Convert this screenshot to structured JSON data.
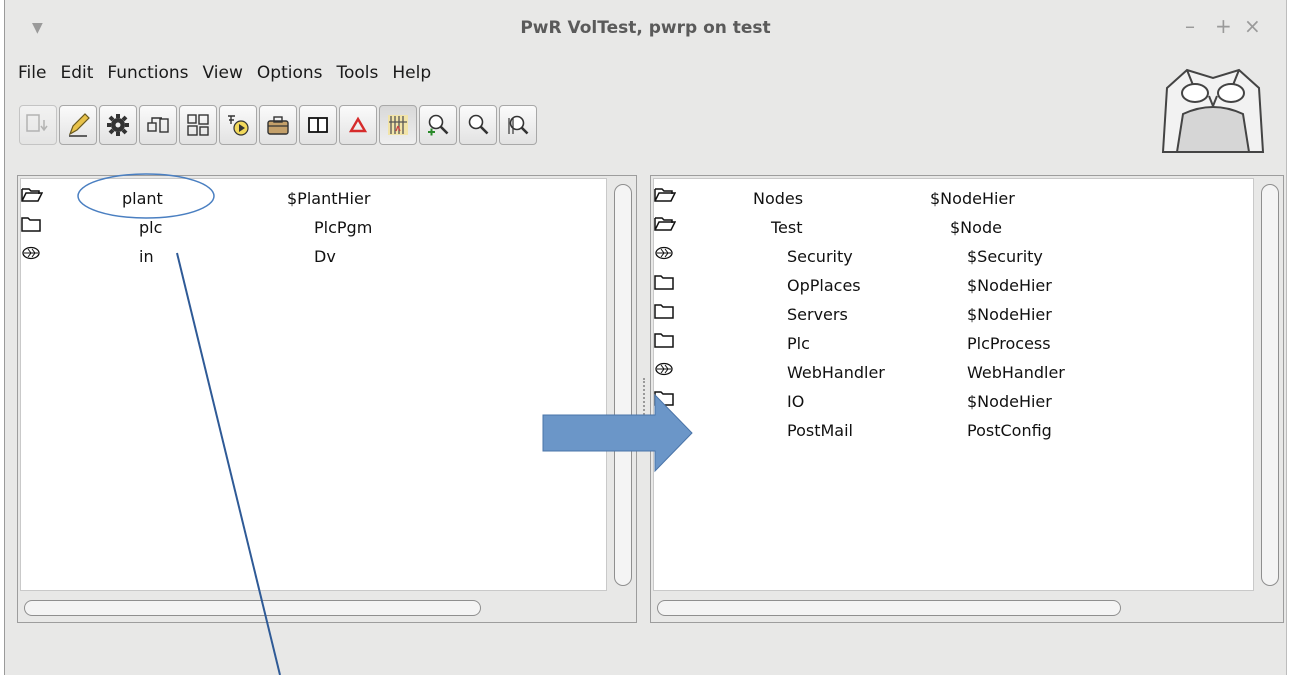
{
  "window": {
    "title": "PwR VolTest,  pwrp on test",
    "controls": [
      "–",
      "+",
      "×"
    ]
  },
  "menubar": [
    "File",
    "Edit",
    "Functions",
    "View",
    "Options",
    "Tools",
    "Help"
  ],
  "toolbar": {
    "buttons": [
      {
        "icon": "import-icon",
        "enabled": false
      },
      {
        "icon": "edit-pencil-icon",
        "enabled": true
      },
      {
        "icon": "gear-icon",
        "enabled": true
      },
      {
        "icon": "hierarchy-icon",
        "enabled": true
      },
      {
        "icon": "object-graph-icon",
        "enabled": true
      },
      {
        "icon": "plc-trace-icon",
        "enabled": true
      },
      {
        "icon": "toolbox-icon",
        "enabled": true
      },
      {
        "icon": "split-view-icon",
        "enabled": true
      },
      {
        "icon": "alarm-triangle-icon",
        "enabled": true
      },
      {
        "icon": "build-icon",
        "enabled": true
      },
      {
        "icon": "zoom-in-icon",
        "enabled": true
      },
      {
        "icon": "zoom-out-icon",
        "enabled": true
      },
      {
        "icon": "zoom-reset-icon",
        "enabled": true
      }
    ]
  },
  "left_pane": {
    "rows": [
      {
        "icon": "folder-open-icon",
        "name": "plant",
        "class": "$PlantHier"
      },
      {
        "icon": "folder-icon",
        "name": "plc",
        "class": "PlcPgm"
      },
      {
        "icon": "leaf-icon",
        "name": "in",
        "class": "Dv"
      }
    ]
  },
  "right_pane": {
    "rows": [
      {
        "icon": "folder-open-icon",
        "name": "Nodes",
        "class": "$NodeHier"
      },
      {
        "icon": "folder-open-icon",
        "name": "Test",
        "class": "$Node"
      },
      {
        "icon": "leaf-icon",
        "name": "Security",
        "class": "$Security"
      },
      {
        "icon": "folder-icon",
        "name": "OpPlaces",
        "class": "$NodeHier"
      },
      {
        "icon": "folder-icon",
        "name": "Servers",
        "class": "$NodeHier"
      },
      {
        "icon": "folder-icon",
        "name": "Plc",
        "class": "PlcProcess"
      },
      {
        "icon": "leaf-icon",
        "name": "WebHandler",
        "class": "WebHandler"
      },
      {
        "icon": "folder-icon",
        "name": "IO",
        "class": "$NodeHier"
      },
      {
        "icon": "leaf-icon",
        "name": "PostMail",
        "class": "PostConfig"
      }
    ]
  },
  "annotations": {
    "arrow_color": "#6b96c8",
    "line_color": "#2f5a96"
  }
}
